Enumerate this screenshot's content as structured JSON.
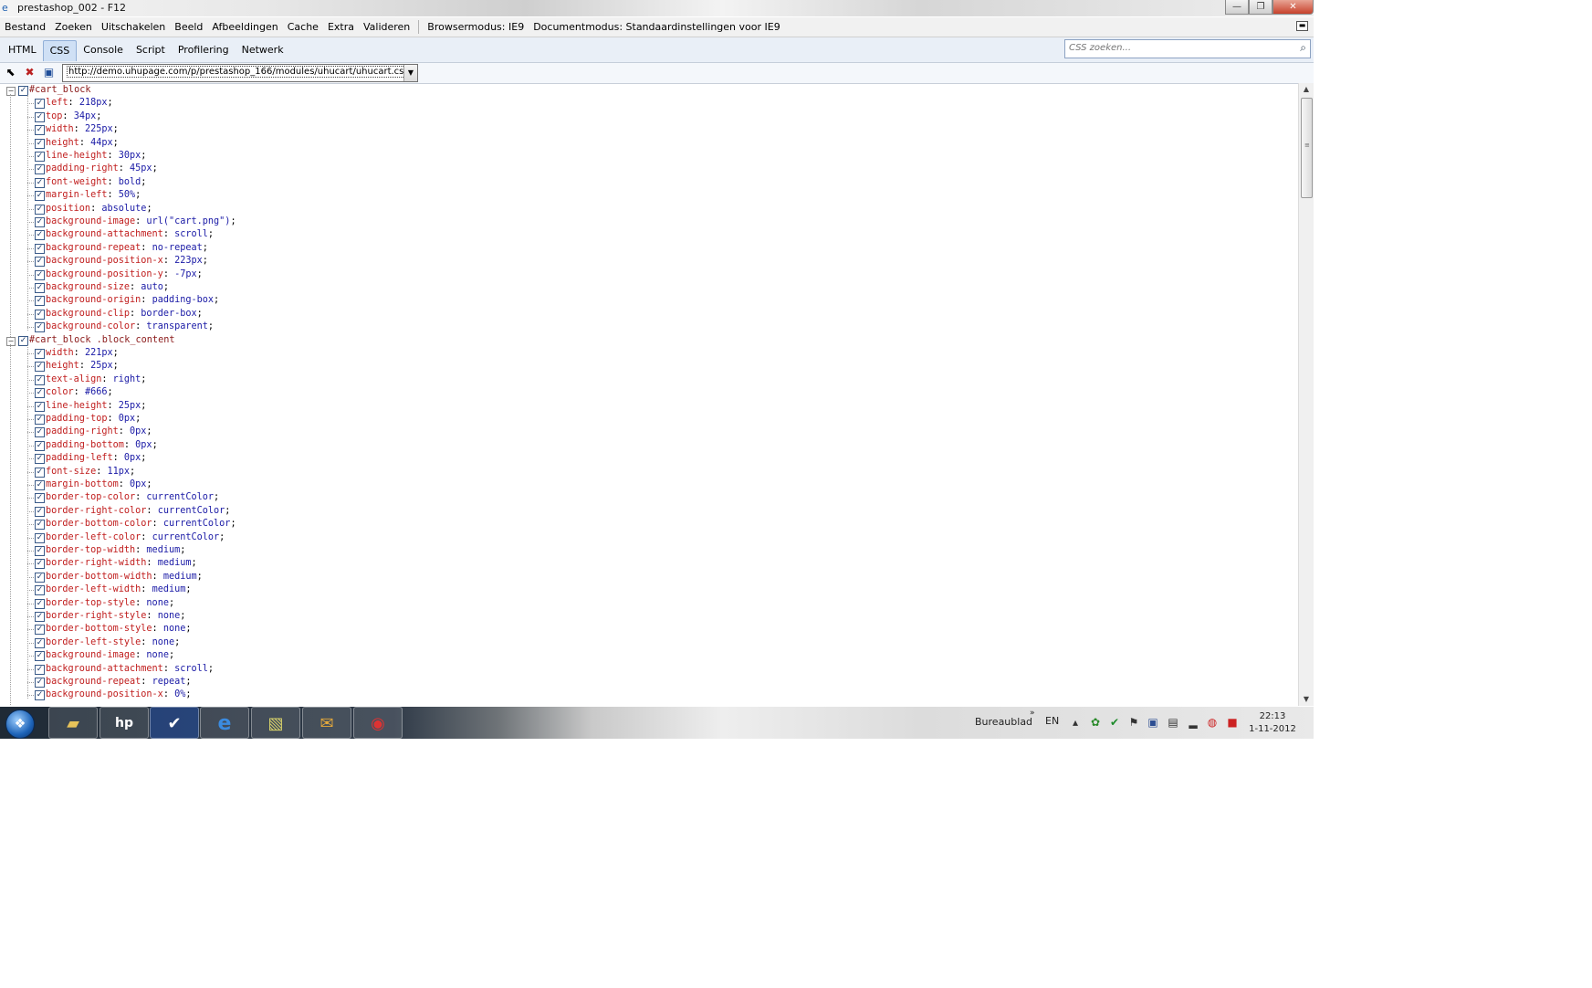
{
  "window": {
    "title": "prestashop_002 - F12",
    "minimize": "—",
    "restore": "❐",
    "close": "✕"
  },
  "menu": [
    "Bestand",
    "Zoeken",
    "Uitschakelen",
    "Beeld",
    "Afbeeldingen",
    "Cache",
    "Extra",
    "Valideren"
  ],
  "modes": {
    "browser": "Browsermodus: IE9",
    "document": "Documentmodus: Standaardinstellingen voor IE9"
  },
  "tabs": [
    "HTML",
    "CSS",
    "Console",
    "Script",
    "Profilering",
    "Netwerk"
  ],
  "active_tab": "CSS",
  "search": {
    "placeholder": "CSS zoeken...",
    "icon": "search-icon"
  },
  "toolbar": {
    "url": "http://demo.uhupage.com/p/prestashop_166/modules/uhucart/uhucart.css"
  },
  "rules": [
    {
      "selector": "#cart_block",
      "props": [
        [
          "left",
          "218px"
        ],
        [
          "top",
          "34px"
        ],
        [
          "width",
          "225px"
        ],
        [
          "height",
          "44px"
        ],
        [
          "line-height",
          "30px"
        ],
        [
          "padding-right",
          "45px"
        ],
        [
          "font-weight",
          "bold"
        ],
        [
          "margin-left",
          "50%"
        ],
        [
          "position",
          "absolute"
        ],
        [
          "background-image",
          "url(\"cart.png\")"
        ],
        [
          "background-attachment",
          "scroll"
        ],
        [
          "background-repeat",
          "no-repeat"
        ],
        [
          "background-position-x",
          "223px"
        ],
        [
          "background-position-y",
          "-7px"
        ],
        [
          "background-size",
          "auto"
        ],
        [
          "background-origin",
          "padding-box"
        ],
        [
          "background-clip",
          "border-box"
        ],
        [
          "background-color",
          "transparent"
        ]
      ]
    },
    {
      "selector": "#cart_block .block_content",
      "props": [
        [
          "width",
          "221px"
        ],
        [
          "height",
          "25px"
        ],
        [
          "text-align",
          "right"
        ],
        [
          "color",
          "#666"
        ],
        [
          "line-height",
          "25px"
        ],
        [
          "padding-top",
          "0px"
        ],
        [
          "padding-right",
          "0px"
        ],
        [
          "padding-bottom",
          "0px"
        ],
        [
          "padding-left",
          "0px"
        ],
        [
          "font-size",
          "11px"
        ],
        [
          "margin-bottom",
          "0px"
        ],
        [
          "border-top-color",
          "currentColor"
        ],
        [
          "border-right-color",
          "currentColor"
        ],
        [
          "border-bottom-color",
          "currentColor"
        ],
        [
          "border-left-color",
          "currentColor"
        ],
        [
          "border-top-width",
          "medium"
        ],
        [
          "border-right-width",
          "medium"
        ],
        [
          "border-bottom-width",
          "medium"
        ],
        [
          "border-left-width",
          "medium"
        ],
        [
          "border-top-style",
          "none"
        ],
        [
          "border-right-style",
          "none"
        ],
        [
          "border-bottom-style",
          "none"
        ],
        [
          "border-left-style",
          "none"
        ],
        [
          "background-image",
          "none"
        ],
        [
          "background-attachment",
          "scroll"
        ],
        [
          "background-repeat",
          "repeat"
        ],
        [
          "background-position-x",
          "0%"
        ]
      ]
    }
  ],
  "taskbar": {
    "apps": [
      "folder-icon",
      "hp-icon",
      "task-icon",
      "ie-icon",
      "sticky-notes-icon",
      "outlook-icon",
      "chrome-icon"
    ],
    "desktop_label": "Bureaublad",
    "language": "EN",
    "time": "22:13",
    "date": "1-11-2012"
  }
}
